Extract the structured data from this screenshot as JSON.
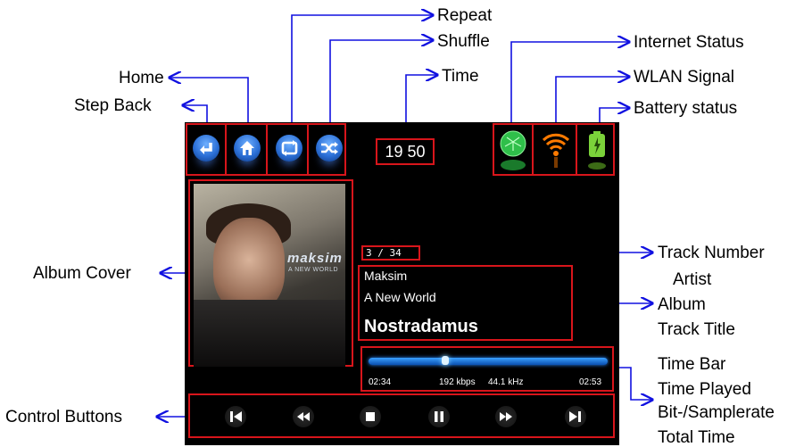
{
  "callouts": {
    "repeat": "Repeat",
    "shuffle": "Shuffle",
    "internet_status": "Internet Status",
    "home": "Home",
    "time": "Time",
    "wlan_signal": "WLAN Signal",
    "step_back": "Step Back",
    "battery_status": "Battery status",
    "track_number": "Track Number",
    "artist": "Artist",
    "album": "Album",
    "album_cover": "Album Cover",
    "track_title": "Track Title",
    "time_bar": "Time Bar",
    "time_played": "Time Played",
    "bitrate_samplerate": "Bit-/Samplerate",
    "control_buttons": "Control Buttons",
    "total_time": "Total Time"
  },
  "player": {
    "clock": "19 50",
    "track_number": "3  /  34",
    "artist": "Maksim",
    "album": "A New World",
    "track_title": "Nostradamus",
    "time_played": "02:34",
    "bitrate": "192 kbps",
    "samplerate": "44.1 kHz",
    "total_time": "02:53",
    "progress_fraction": 0.32
  },
  "cover": {
    "artist_text": "maksim",
    "album_text": "A NEW WORLD"
  },
  "colors": {
    "highlight_box": "#d8151b",
    "arrow": "#1010e0",
    "top_button": "#2b6fd6",
    "internet_icon": "#2fbf4a",
    "wlan_icon": "#ff7a00",
    "battery_icon": "#7bd23a"
  },
  "icons": [
    "step-back-icon",
    "home-icon",
    "repeat-icon",
    "shuffle-icon",
    "internet-status-icon",
    "wlan-signal-icon",
    "battery-icon",
    "skip-previous-icon",
    "rewind-icon",
    "stop-icon",
    "pause-icon",
    "fast-forward-icon",
    "skip-next-icon"
  ]
}
